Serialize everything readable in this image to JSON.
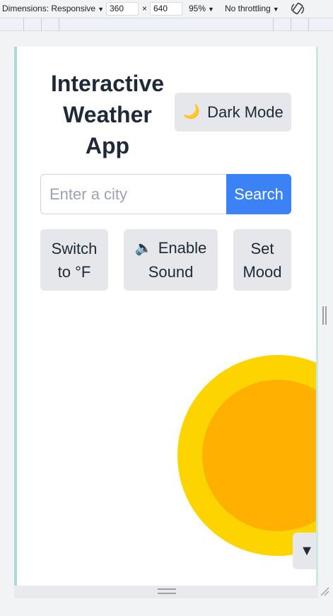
{
  "devtools": {
    "dimensions_label": "Dimensions: Responsive",
    "caret": "▼",
    "width_value": "360",
    "times": "×",
    "height_value": "640",
    "zoom": "95%",
    "throttling": "No throttling",
    "rotate_icon": "rotate-icon"
  },
  "app": {
    "title": "Interactive Weather App",
    "dark_mode": {
      "icon": "🌙",
      "label": "Dark Mode"
    },
    "search": {
      "placeholder": "Enter a city",
      "button_label": "Search"
    },
    "unit_toggle_label": "Switch to °F",
    "sound": {
      "icon": "🔈",
      "label": "Enable Sound"
    },
    "mood_label": "Set Mood",
    "scroll_glyph": "▼",
    "colors": {
      "accent": "#3b82f6",
      "sun_outer": "#fdd300",
      "sun_inner": "#ffb000",
      "button_bg": "#e5e7eb"
    }
  }
}
